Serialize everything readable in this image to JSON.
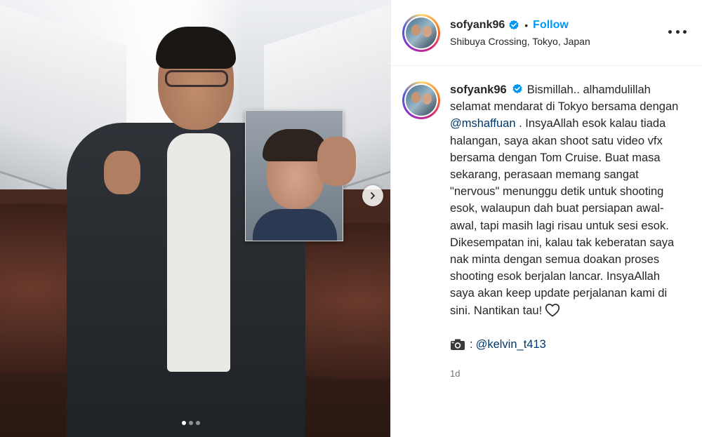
{
  "post": {
    "username": "sofyank96",
    "follow_label": "Follow",
    "bullet": "•",
    "location": "Shibuya Crossing, Tokyo, Japan",
    "caption": {
      "username": "sofyank96",
      "part1": "Bismillah.. alhamdulillah selamat mendarat di Tokyo bersama dengan",
      "mention": "@mshaffuan",
      "part2": ". InsyaAllah esok kalau tiada halangan, saya akan shoot satu video vfx bersama dengan Tom Cruise. Buat masa sekarang, perasaan memang sangat \"nervous\" menunggu detik untuk shooting esok, walaupun dah buat persiapan awal-awal, tapi masih lagi risau untuk sesi esok. Dikesempatan ini, kalau tak keberatan saya nak minta dengan semua doakan proses shooting esok berjalan lancar. InsyaAllah saya akan keep update perjalanan kami di sini. Nantikan tau!",
      "credit_colon": ":",
      "credit_mention": "@kelvin_t413",
      "time": "1d"
    },
    "carousel": {
      "slide_count": 3,
      "active_index": 0
    },
    "icons": {
      "verified": "verified-badge-icon",
      "more": "more-options-icon",
      "next": "chevron-right-icon",
      "heart": "heart-icon",
      "camera": "camera-icon"
    },
    "colors": {
      "follow": "#0095f6",
      "verified": "#0095f6",
      "mention": "#00376b",
      "time": "#737373"
    }
  }
}
